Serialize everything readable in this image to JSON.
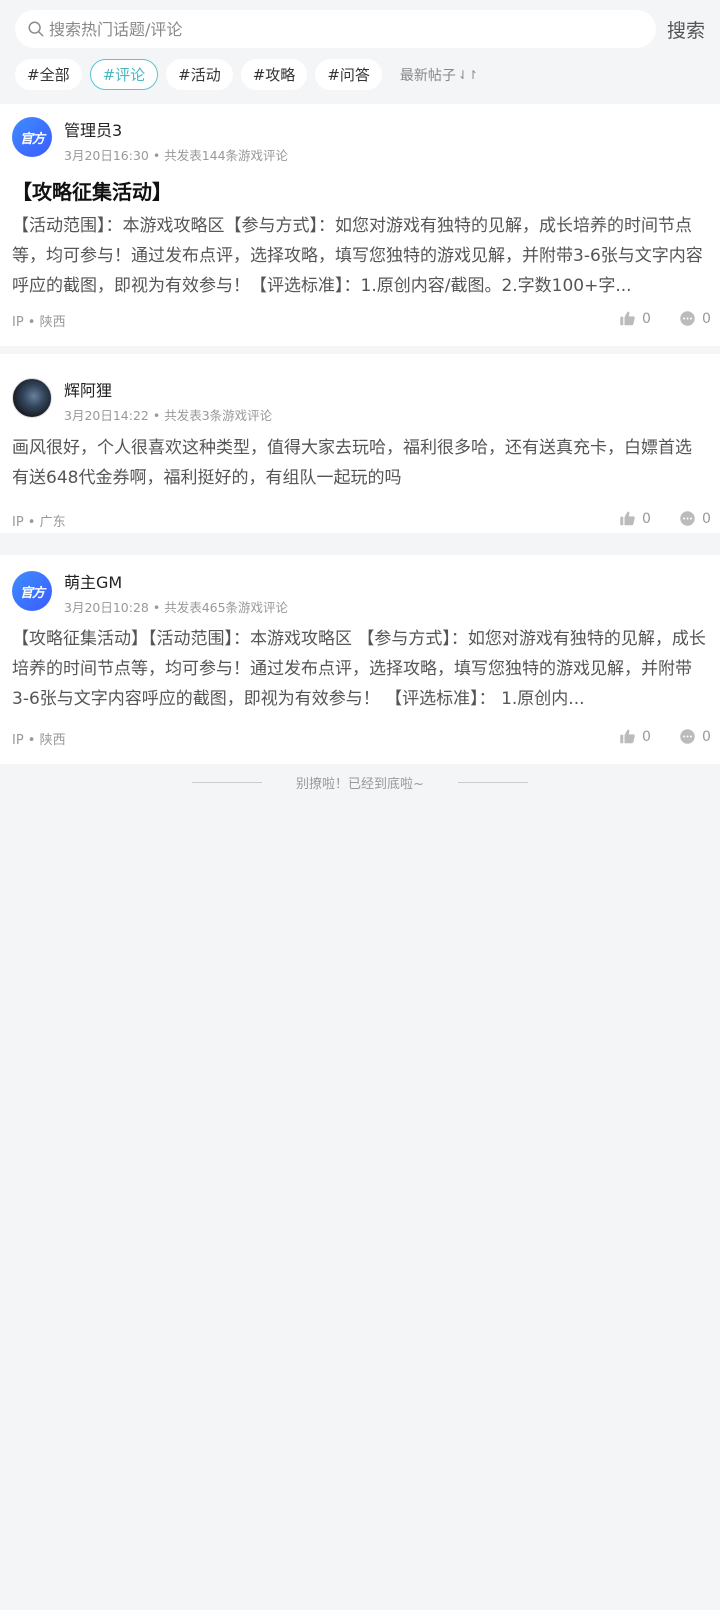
{
  "search": {
    "placeholder": "搜索热门话题/评论",
    "button": "搜索"
  },
  "tags": [
    {
      "label": "#全部",
      "active": false
    },
    {
      "label": "#评论",
      "active": true
    },
    {
      "label": "#活动",
      "active": false
    },
    {
      "label": "#攻略",
      "active": false
    },
    {
      "label": "#问答",
      "active": false
    }
  ],
  "sort": {
    "label": "最新帖子",
    "icon": "sort-arrows-icon"
  },
  "posts": [
    {
      "username": "管理员3",
      "avatar": "官方",
      "meta": "3月20日16:30 • 共发表144条游戏评论",
      "title": "【攻略征集活动】",
      "body": "【活动范围】：本游戏攻略区【参与方式】：如您对游戏有独特的见解，成长培养的时间节点等，均可参与！通过发布点评，选择攻略，填写您独特的游戏见解，并附带3-6张与文字内容呼应的截图，即视为有效参与！【评选标准】：1.原创内容/截图。2.字数100+字...",
      "ip": "IP • 陕西",
      "likes": "0",
      "comments": "0"
    },
    {
      "username": "辉阿狸",
      "meta": "3月20日14:22 • 共发表3条游戏评论",
      "body": "画风很好，个人很喜欢这种类型，值得大家去玩哈，福利很多哈，还有送真充卡，白嫖首选 有送648代金券啊，福利挺好的，有组队一起玩的吗",
      "ip": "IP • 广东",
      "likes": "0",
      "comments": "0"
    },
    {
      "username": "萌主GM",
      "avatar": "官方",
      "meta": "3月20日10:28 • 共发表465条游戏评论",
      "body": "【攻略征集活动】【活动范围】：本游戏攻略区 【参与方式】：如您对游戏有独特的见解，成长培养的时间节点等，均可参与！通过发布点评，选择攻略，填写您独特的游戏见解，并附带3-6张与文字内容呼应的截图，即视为有效参与！ 【评选标准】： 1.原创内...",
      "ip": "IP • 陕西",
      "likes": "0",
      "comments": "0"
    }
  ],
  "footer": "别撩啦！已经到底啦~",
  "colors": {
    "accent": "#4ab8c2",
    "official_avatar": "#3f6dff",
    "background": "#f4f5f7"
  }
}
